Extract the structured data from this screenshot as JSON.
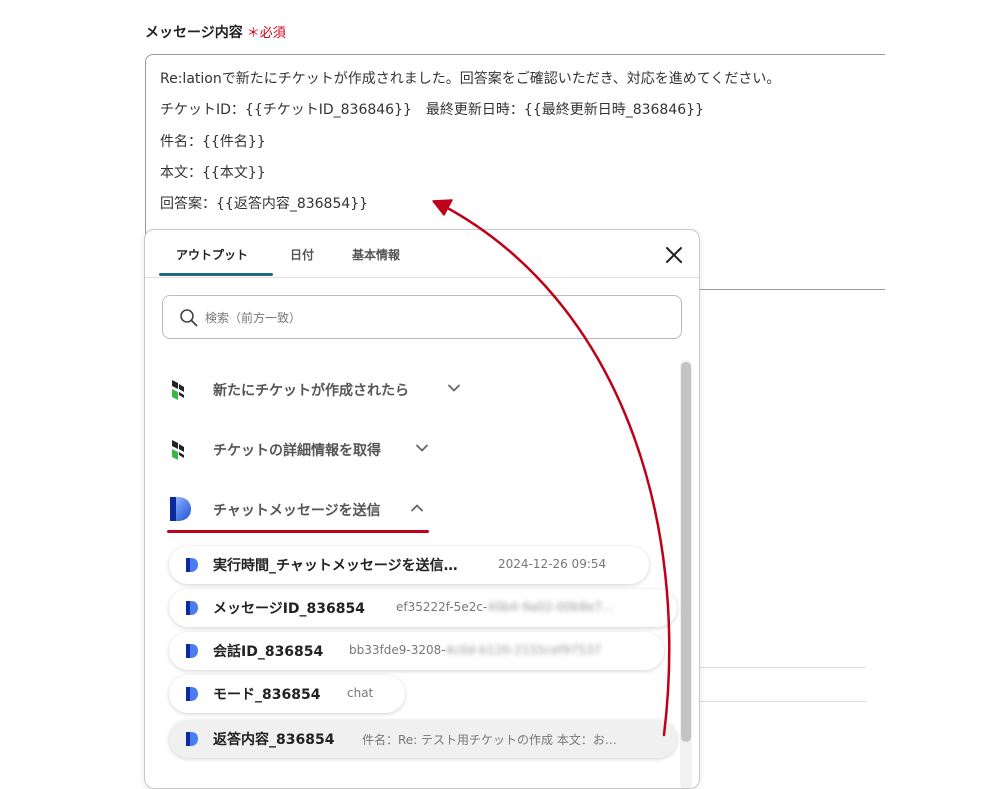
{
  "field": {
    "label": "メッセージ内容",
    "required": "＊必須"
  },
  "message": {
    "lines": [
      "Re:lationで新たにチケットが作成されました。回答案をご確認いただき、対応を進めてください。",
      "チケットID：{{チケットID_836846}}　最終更新日時：{{最終更新日時_836846}}",
      "件名：{{件名}}",
      "本文：{{本文}}",
      "回答案：{{返答内容_836854}}"
    ]
  },
  "popup": {
    "tabs": [
      "アウトプット",
      "日付",
      "基本情報"
    ],
    "search_placeholder": "検索（前方一致）",
    "sections": [
      "新たにチケットが作成されたら",
      "チケットの詳細情報を取得",
      "チャットメッセージを送信"
    ],
    "items": [
      {
        "name": "実行時間_チャットメッセージを送信…",
        "value": "2024-12-26 09:54",
        "value_blur": ""
      },
      {
        "name": "メッセージID_836854",
        "value": "ef35222f-5e2c-",
        "value_blur": "40b4-9a02-00b8e7…"
      },
      {
        "name": "会話ID_836854",
        "value": "bb33fde9-3208-",
        "value_blur": "4c0d-b120-2155cef97537"
      },
      {
        "name": "モード_836854",
        "value": "chat",
        "value_blur": ""
      },
      {
        "name": "返答内容_836854",
        "value": "件名：Re: テスト用チケットの作成 本文：お…",
        "value_blur": ""
      }
    ]
  },
  "colors": {
    "accent_tab": "#1e6b7b",
    "annotation_red": "#c00018",
    "required_red": "#d0021b"
  },
  "icons": {
    "close": "close-icon",
    "search": "search-icon",
    "relation_app": "relation-app-icon",
    "chat_app": "chat-app-icon",
    "chevron_down": "chevron-down-icon",
    "chevron_up": "chevron-up-icon"
  }
}
